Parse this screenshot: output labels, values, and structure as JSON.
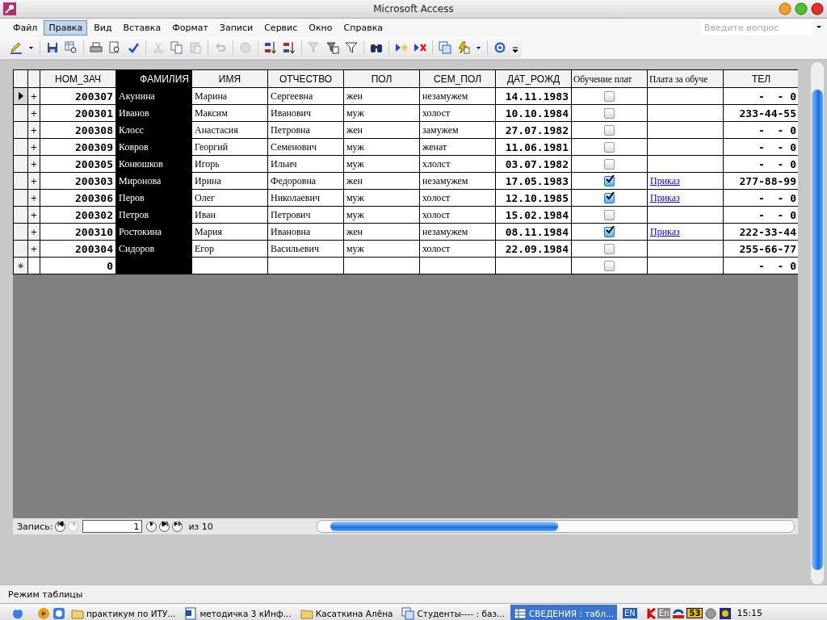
{
  "window": {
    "title": "Microsoft Access"
  },
  "menu": [
    {
      "label": "Файл",
      "selected": false
    },
    {
      "label": "Правка",
      "selected": true
    },
    {
      "label": "Вид",
      "selected": false
    },
    {
      "label": "Вставка",
      "selected": false
    },
    {
      "label": "Формат",
      "selected": false
    },
    {
      "label": "Записи",
      "selected": false
    },
    {
      "label": "Сервис",
      "selected": false
    },
    {
      "label": "Окно",
      "selected": false
    },
    {
      "label": "Справка",
      "selected": false
    }
  ],
  "help_search": {
    "placeholder": "Введите вопрос"
  },
  "table": {
    "columns": [
      {
        "label": "НОМ_ЗАЧ",
        "selected": false
      },
      {
        "label": "ФАМИЛИЯ",
        "selected": true
      },
      {
        "label": "ИМЯ",
        "selected": false
      },
      {
        "label": "ОТЧЕСТВО",
        "selected": false
      },
      {
        "label": "ПОЛ",
        "selected": false
      },
      {
        "label": "СЕМ_ПОЛ",
        "selected": false
      },
      {
        "label": "ДАТ_РОЖД",
        "selected": false
      },
      {
        "label": "Обучение плат",
        "selected": false
      },
      {
        "label": "Плата за обуче",
        "selected": false
      },
      {
        "label": "ТЕЛ",
        "selected": false
      }
    ],
    "rows": [
      {
        "selected": true,
        "expander": "+",
        "cells": [
          "200307",
          "Акунина",
          "Марина",
          "Сергеевна",
          "жен",
          "незамужем",
          "14.11.1983"
        ],
        "paid": false,
        "tel": "-  - 0"
      },
      {
        "selected": false,
        "expander": "+",
        "cells": [
          "200301",
          "Иванов",
          "Максим",
          "Иванович",
          "муж",
          "холост",
          "10.10.1984"
        ],
        "paid": false,
        "tel": "233-44-55"
      },
      {
        "selected": false,
        "expander": "+",
        "cells": [
          "200308",
          "Клосс",
          "Анастасия",
          "Петровна",
          "жен",
          "замужем",
          "27.07.1982"
        ],
        "paid": false,
        "tel": "-  - 0"
      },
      {
        "selected": false,
        "expander": "+",
        "cells": [
          "200309",
          "Ковров",
          "Георгий",
          "Семенович",
          "муж",
          "женат",
          "11.06.1981"
        ],
        "paid": false,
        "tel": "-  - 0"
      },
      {
        "selected": false,
        "expander": "+",
        "cells": [
          "200305",
          "Конюшков",
          "Игорь",
          "Ильич",
          "муж",
          "хлолст",
          "03.07.1982"
        ],
        "paid": false,
        "tel": "-  - 0"
      },
      {
        "selected": false,
        "expander": "+",
        "cells": [
          "200303",
          "Миронова",
          "Ирина",
          "Федоровна",
          "жен",
          "незамужем",
          "17.05.1983"
        ],
        "paid": true,
        "link": "Приказ",
        "tel": "277-88-99"
      },
      {
        "selected": false,
        "expander": "+",
        "cells": [
          "200306",
          "Перов",
          "Олег",
          "Николаевич",
          "муж",
          "холост",
          "12.10.1985"
        ],
        "paid": true,
        "link": "Приказ",
        "tel": "-  - 0"
      },
      {
        "selected": false,
        "expander": "+",
        "cells": [
          "200302",
          "Петров",
          "Иван",
          "Петрович",
          "муж",
          "холост",
          "15.02.1984"
        ],
        "paid": false,
        "tel": "-  - 0"
      },
      {
        "selected": false,
        "expander": "+",
        "cells": [
          "200310",
          "Ростокина",
          "Мария",
          "Ивановна",
          "жен",
          "незамужем",
          "08.11.1984"
        ],
        "paid": true,
        "link": "Приказ",
        "tel": "222-33-44"
      },
      {
        "selected": false,
        "expander": "+",
        "cells": [
          "200304",
          "Сидоров",
          "Егор",
          "Васильевич",
          "муж",
          "холост",
          "22.09.1984"
        ],
        "paid": false,
        "tel": "255-66-77"
      }
    ],
    "new_row": {
      "marker": "✳",
      "number": "0",
      "paid": false,
      "tel": "-  - 0"
    }
  },
  "navigator": {
    "label": "Запись:",
    "value": "1",
    "total": "из 10"
  },
  "status_bar": {
    "text": "Режим таблицы"
  },
  "taskbar": {
    "items": [
      {
        "label": "практикум по ИТУ...",
        "kind": "folder",
        "selected": false
      },
      {
        "label": "методичка 3 кИнф...",
        "kind": "document",
        "selected": false
      },
      {
        "label": "Касаткина Алёна",
        "kind": "folder",
        "selected": false
      },
      {
        "label": "Студенты---- : баз...",
        "kind": "database",
        "selected": false
      },
      {
        "label": "СВЕДЕНИЯ : табл...",
        "kind": "table",
        "selected": true
      }
    ],
    "language": "EN",
    "tray_language": "En",
    "tray_badge": "53",
    "clock": "15:15"
  }
}
